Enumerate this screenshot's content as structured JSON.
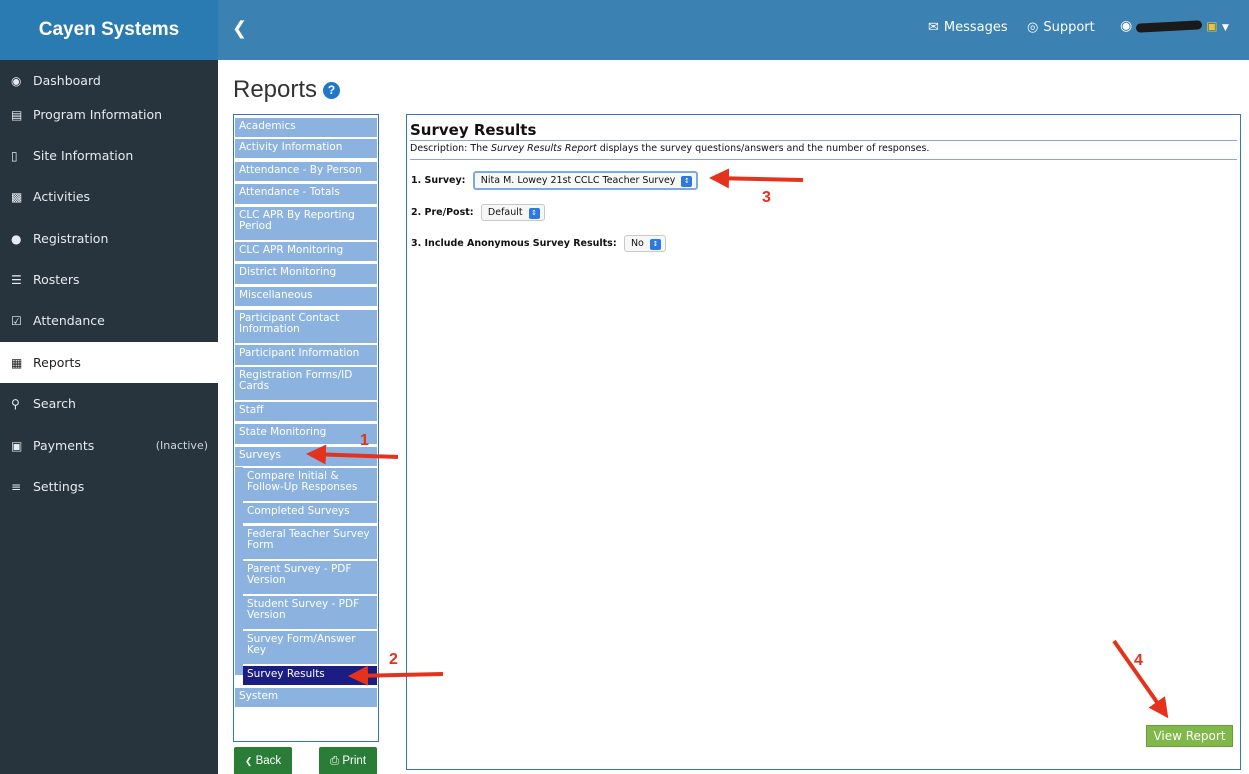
{
  "header": {
    "brand": "Cayen Systems",
    "collapse_icon": "chevron-left-icon",
    "messages_label": "Messages",
    "support_label": "Support"
  },
  "sidebar": {
    "items": [
      {
        "label": "Dashboard",
        "icon": "tachometer-icon"
      },
      {
        "label": "Program Information",
        "icon": "institution-icon"
      },
      {
        "label": "Site Information",
        "icon": "building-icon"
      },
      {
        "label": "Activities",
        "icon": "sitemap-icon"
      },
      {
        "label": "Registration",
        "icon": "users-icon"
      },
      {
        "label": "Rosters",
        "icon": "list-icon"
      },
      {
        "label": "Attendance",
        "icon": "calendar-check-icon"
      },
      {
        "label": "Reports",
        "icon": "bar-chart-icon"
      },
      {
        "label": "Search",
        "icon": "search-icon"
      },
      {
        "label": "Payments",
        "icon": "money-icon",
        "badge": "(Inactive)"
      },
      {
        "label": "Settings",
        "icon": "sliders-icon"
      }
    ],
    "active": "Reports"
  },
  "page": {
    "title": "Reports"
  },
  "report_menu": {
    "categories": [
      "Academics",
      "Activity Information",
      "Attendance - By Person",
      "Attendance - Totals",
      "CLC APR By Reporting Period",
      "CLC APR Monitoring",
      "District Monitoring",
      "Miscellaneous",
      "Participant Contact Information",
      "Participant Information",
      "Registration Forms/ID Cards",
      "Staff",
      "State Monitoring",
      "Surveys",
      "System"
    ],
    "survey_items": [
      "Compare Initial & Follow-Up Responses",
      "Completed Surveys",
      "Federal Teacher Survey Form",
      "Parent Survey - PDF Version",
      "Student Survey - PDF Version",
      "Survey Form/Answer Key",
      "Survey Results"
    ],
    "selected": "Survey Results"
  },
  "buttons": {
    "back": "Back",
    "print": "Print",
    "view_report": "View Report"
  },
  "report": {
    "title": "Survey Results",
    "description_prefix": "Description: The ",
    "description_em": "Survey Results Report",
    "description_suffix": " displays the survey questions/answers and the number of responses.",
    "q1_label": "1. Survey:",
    "q1_value": "Nita M. Lowey 21st CCLC Teacher Survey",
    "q2_label": "2. Pre/Post:",
    "q2_value": "Default",
    "q3_label": "3. Include Anonymous Survey Results:",
    "q3_value": "No"
  },
  "annotations": [
    "1",
    "2",
    "3",
    "4"
  ],
  "colors": {
    "topbar": "#3b81b1",
    "sidebar": "#27333d",
    "menu_item": "#8cb3df",
    "menu_selected": "#1b1d83",
    "green_button": "#2a7d36",
    "view_report": "#80b94a",
    "annotation": "#e5321c"
  }
}
